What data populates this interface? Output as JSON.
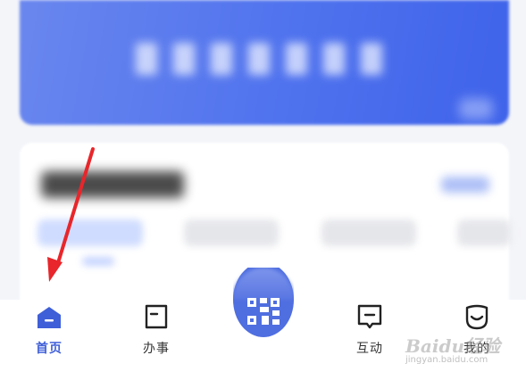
{
  "tabs": [
    {
      "key": "home",
      "label": "首页",
      "icon": "home-icon",
      "active": true
    },
    {
      "key": "banshi",
      "label": "办事",
      "icon": "document-icon",
      "active": false
    },
    {
      "key": "scan",
      "label": "",
      "icon": "qr-code-icon",
      "active": false
    },
    {
      "key": "hudong",
      "label": "互动",
      "icon": "chat-bubble-icon",
      "active": false
    },
    {
      "key": "mine",
      "label": "我的",
      "icon": "smile-face-icon",
      "active": false
    }
  ],
  "colors": {
    "accent": "#3f5fd8",
    "banner": "#4f72ee",
    "annotation_arrow": "#e8262b",
    "tab_text": "#333333"
  },
  "watermark": {
    "logo": "Baidu经验",
    "url": "jingyan.baidu.com"
  }
}
